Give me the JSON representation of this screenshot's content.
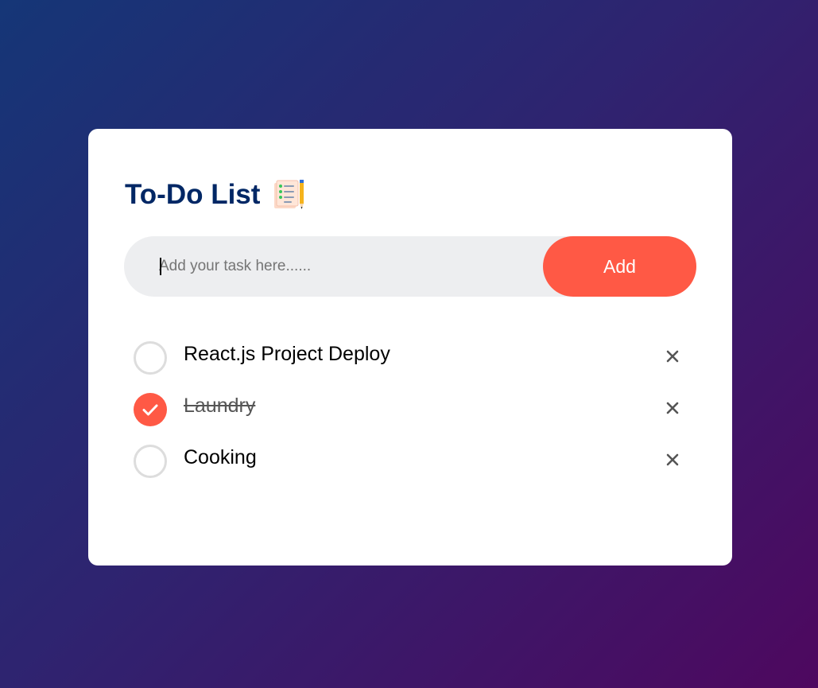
{
  "app": {
    "title": "To-Do List",
    "title_icon": "notepad-checklist-icon"
  },
  "colors": {
    "background_start": "#153677",
    "background_end": "#4e085f",
    "title": "#002765",
    "accent": "#ff5945",
    "input_bg": "#edeef0"
  },
  "input": {
    "value": "",
    "placeholder": "Add your task here......"
  },
  "add_button": {
    "label": "Add"
  },
  "tasks": [
    {
      "label": "React.js Project Deploy",
      "completed": false,
      "remove_icon": "close-icon"
    },
    {
      "label": "Laundry",
      "completed": true,
      "remove_icon": "close-icon"
    },
    {
      "label": "Cooking",
      "completed": false,
      "remove_icon": "close-icon"
    }
  ]
}
